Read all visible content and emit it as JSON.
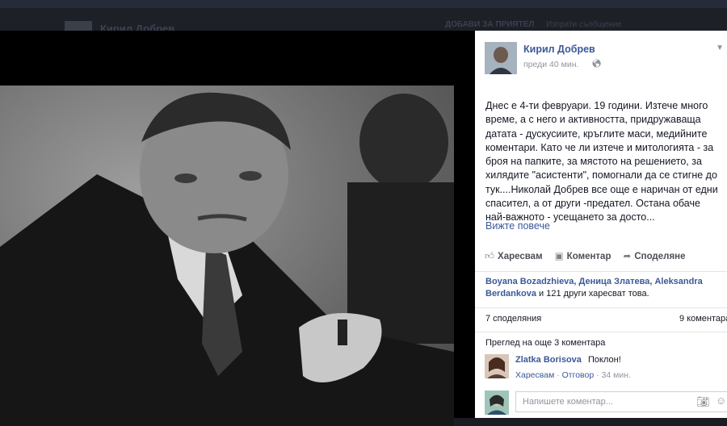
{
  "background": {
    "profile_name": "Кирил Добрев",
    "add_friend": "ДОБАВИ ЗА ПРИЯТЕЛ",
    "message": "Изпрати съобщение"
  },
  "post": {
    "author": "Кирил Добрев",
    "time": "преди 40 мин.",
    "audience_icon": "globe-icon",
    "text_lines": [
      "Днес е 4-ти февруари. 19 години. Изтече много",
      "време, а с него и активността, придружаваща",
      "датата - дускусиите, кръглите маси, медийните",
      "коментари. Като че ли изтече и митологията - за",
      "броя на папките, за мястото на решението, за",
      "хилядите \"асистенти\", помогнали да се стигне до",
      "тук....Николай Добрев все още е наричан от едни",
      "спасител, а от други -предател. Остана обаче",
      "най-важното - усещането за досто..."
    ],
    "see_more": "Вижте повече"
  },
  "actions": {
    "like": "Харесвам",
    "comment": "Коментар",
    "share": "Споделяне"
  },
  "likes": {
    "names": "Boyana Bozadzhieva, Деница Златева, Aleksandra Berdankova",
    "rest": " и 121 други харесват това."
  },
  "stats": {
    "shares": "7 споделяния",
    "comments": "9 коментара"
  },
  "comments": {
    "view_more": "Преглед на още 3 коментара",
    "items": [
      {
        "author": "Zlatka Borisova",
        "text": "Поклон!",
        "like": "Харесвам",
        "reply": "Отговор",
        "time": "34 мин."
      }
    ],
    "input_placeholder": "Напишете коментар..."
  },
  "colors": {
    "link": "#3b5998",
    "text": "#141823",
    "muted": "#90949c",
    "overlay": "#000000"
  }
}
